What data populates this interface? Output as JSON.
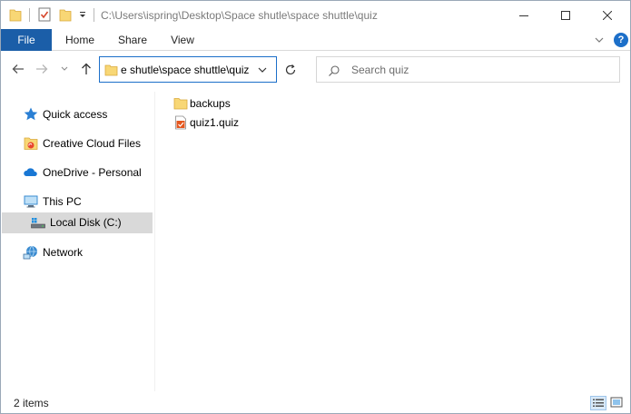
{
  "window": {
    "title_path": "C:\\Users\\ispring\\Desktop\\Space shutle\\space shuttle\\quiz"
  },
  "ribbon": {
    "tabs": [
      {
        "label": "File"
      },
      {
        "label": "Home"
      },
      {
        "label": "Share"
      },
      {
        "label": "View"
      }
    ],
    "help": "?"
  },
  "address": {
    "visible_text": "e shutle\\space shuttle\\quiz"
  },
  "search": {
    "placeholder": "Search quiz",
    "value": ""
  },
  "sidebar": {
    "items": [
      {
        "label": "Quick access",
        "icon": "star-icon"
      },
      {
        "label": "Creative Cloud Files",
        "icon": "creative-cloud-folder-icon"
      },
      {
        "label": "OneDrive - Personal",
        "icon": "onedrive-cloud-icon"
      },
      {
        "label": "This PC",
        "icon": "computer-icon"
      },
      {
        "label": "Local Disk (C:)",
        "icon": "drive-icon",
        "selected": true
      },
      {
        "label": "Network",
        "icon": "network-icon"
      }
    ]
  },
  "files": [
    {
      "name": "backups",
      "type": "folder"
    },
    {
      "name": "quiz1.quiz",
      "type": "quiz-file"
    }
  ],
  "status": {
    "items_count": "2 items"
  },
  "colors": {
    "file_tab": "#1b5ea8",
    "accent": "#1c6fc9",
    "folder": "#f8d775",
    "selection": "#d9d9d9"
  }
}
